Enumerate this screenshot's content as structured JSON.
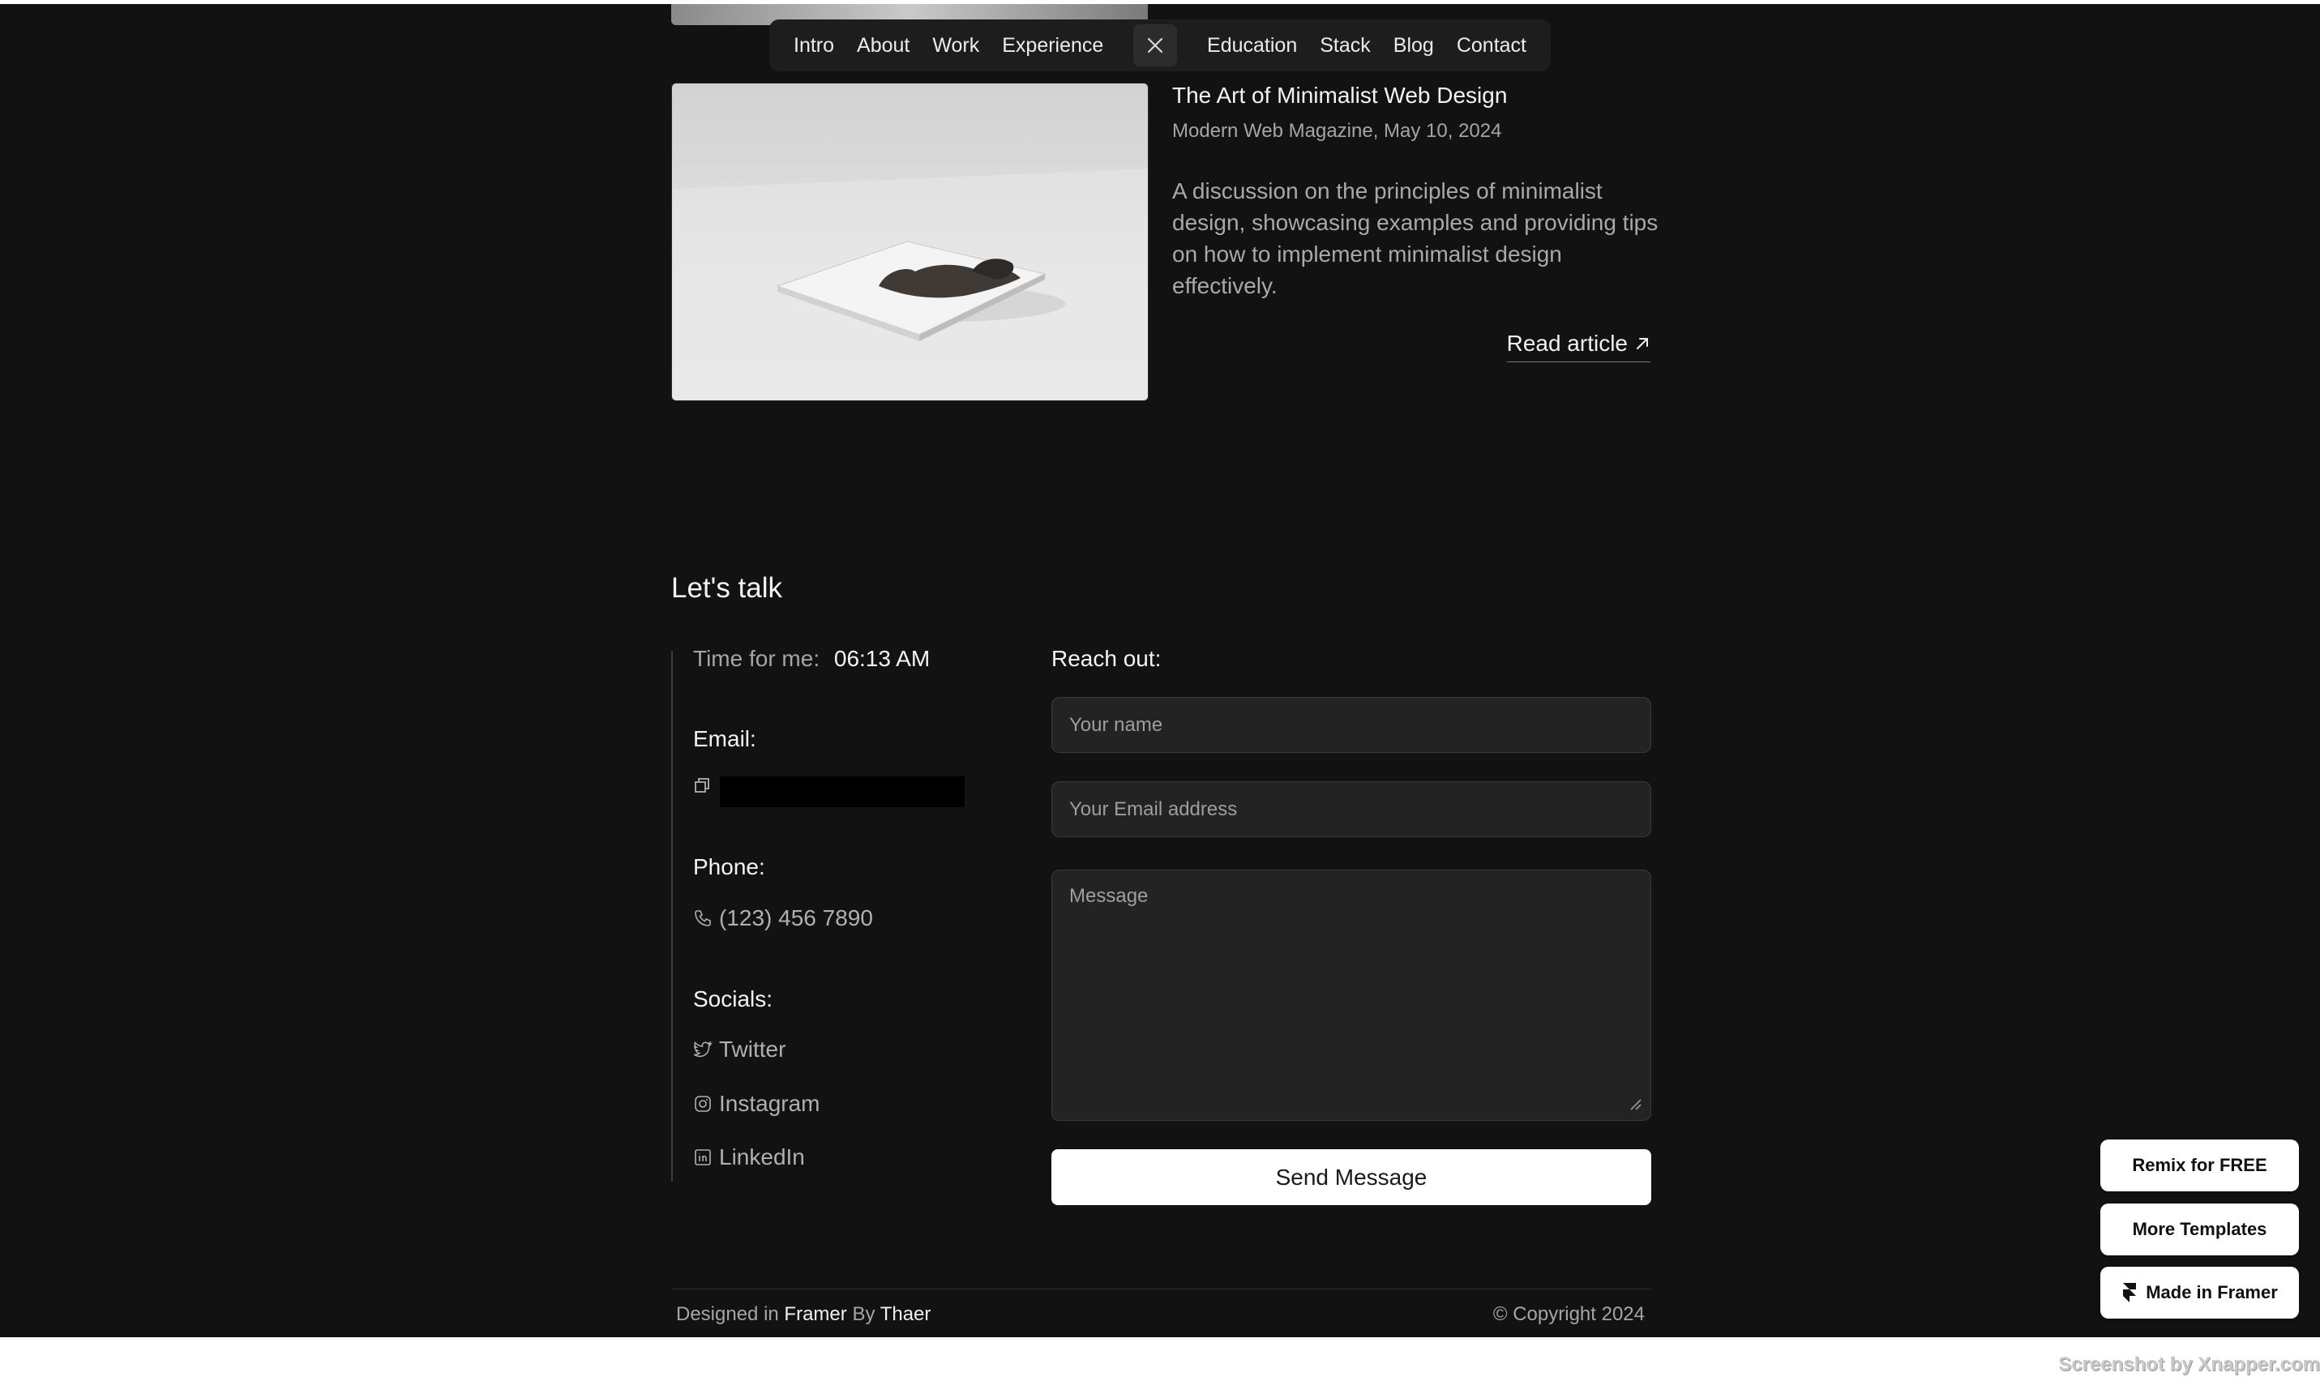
{
  "nav": {
    "items_left": [
      "Intro",
      "About",
      "Work",
      "Experience"
    ],
    "items_right": [
      "Education",
      "Stack",
      "Blog",
      "Contact"
    ],
    "close_icon": "close-icon"
  },
  "article": {
    "title": "The Art of Minimalist Web Design",
    "meta": "Modern Web Magazine, May 10, 2024",
    "description": "A discussion on the principles of minimalist design, showcasing examples and providing tips on how to implement minimalist design effectively.",
    "read_label": "Read article",
    "read_icon": "arrow-up-right-icon"
  },
  "contact": {
    "heading": "Let's talk",
    "time_label": "Time for me:",
    "time_value": "06:13 AM",
    "email_label": "Email:",
    "email_icon": "copy-icon",
    "phone_label": "Phone:",
    "phone_value": "(123) 456 7890",
    "phone_icon": "phone-icon",
    "socials_label": "Socials:",
    "socials": [
      {
        "label": "Twitter",
        "icon": "twitter-icon"
      },
      {
        "label": "Instagram",
        "icon": "instagram-icon"
      },
      {
        "label": "LinkedIn",
        "icon": "linkedin-icon"
      }
    ],
    "form": {
      "heading": "Reach out:",
      "name_placeholder": "Your name",
      "email_placeholder": "Your Email address",
      "message_placeholder": "Message",
      "submit_label": "Send Message"
    }
  },
  "footer": {
    "designed_in": "Designed in",
    "tool": "Framer",
    "by": "By",
    "author": "Thaer",
    "copyright": "© Copyright 2024"
  },
  "badges": {
    "remix": "Remix for FREE",
    "templates": "More Templates",
    "made_in": "Made in Framer"
  },
  "watermark": "Screenshot by Xnapper.com",
  "colors": {
    "background": "#121212",
    "surface": "#232323",
    "text": "#f3f3f3",
    "muted": "#a5a5a5"
  }
}
